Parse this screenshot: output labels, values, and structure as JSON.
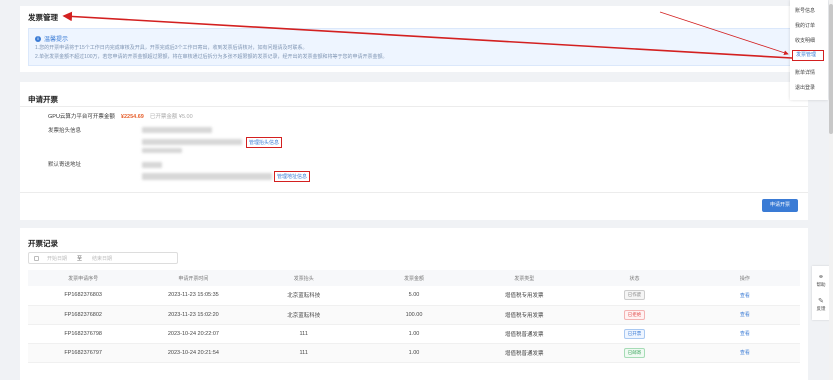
{
  "billing": {
    "title": "发票管理",
    "tips_title": "温馨提示",
    "tips_lines": [
      "1.您的开票申请将于15个工作日内完成审核及开具，开票完成后3个工作日寄出，收到发票后请核对，如有问题请及时联系。",
      "2.单张发票金额不超过100万，若您申请的开票金额超过限额，将在审核通过后拆分为多张不超限额的发票记录，经开出的发票金额和将等于您的申请开票金额。"
    ]
  },
  "apply": {
    "title": "申请开票",
    "amount_label": "GPU云算力平台可开票金额",
    "amount_value": "¥2254.69",
    "amount_issued": "已开票金额 ¥5.00",
    "header_label": "发票抬头信息",
    "manage_header": "管理抬头信息",
    "address_label": "默认寄送地址",
    "manage_address": "管理地址信息",
    "apply_button": "申请开票"
  },
  "records": {
    "title": "开票记录",
    "date_start_placeholder": "开始日期",
    "date_sep": "至",
    "date_end_placeholder": "结束日期",
    "columns": [
      "发票申请序号",
      "申请开票时间",
      "发票抬头",
      "发票金额",
      "发票类型",
      "状态",
      "操作"
    ],
    "rows": [
      {
        "id": "FP1682376803",
        "time": "2023-11-23 15:05:35",
        "header": "北京蓝耘科技",
        "amount": "5.00",
        "type": "增值税专用发票",
        "status": "已作废",
        "status_class": "st-cancelled",
        "action": "查看"
      },
      {
        "id": "FP1682376802",
        "time": "2023-11-23 15:02:20",
        "header": "北京蓝耘科技",
        "amount": "100.00",
        "type": "增值税专用发票",
        "status": "已拒绝",
        "status_class": "st-rejected",
        "action": "查看"
      },
      {
        "id": "FP1682376798",
        "time": "2023-10-24 20:22:07",
        "header": "111",
        "amount": "1.00",
        "type": "增值税普通发票",
        "status": "已开票",
        "status_class": "st-issued",
        "action": "查看"
      },
      {
        "id": "FP1682376797",
        "time": "2023-10-24 20:21:54",
        "header": "111",
        "amount": "1.00",
        "type": "增值税普通发票",
        "status": "已邮寄",
        "status_class": "st-mailed",
        "action": "查看"
      }
    ]
  },
  "menu": {
    "items": [
      "账号信息",
      "我的订单",
      "收支明细",
      "发票管理",
      "账单详情",
      "退出登录"
    ],
    "active_index": 3
  },
  "float_bar": {
    "help": "帮助",
    "feedback": "反馈"
  },
  "colors": {
    "primary": "#3a7bd5",
    "amount": "#e6602d",
    "annotation_red": "#d32020"
  }
}
